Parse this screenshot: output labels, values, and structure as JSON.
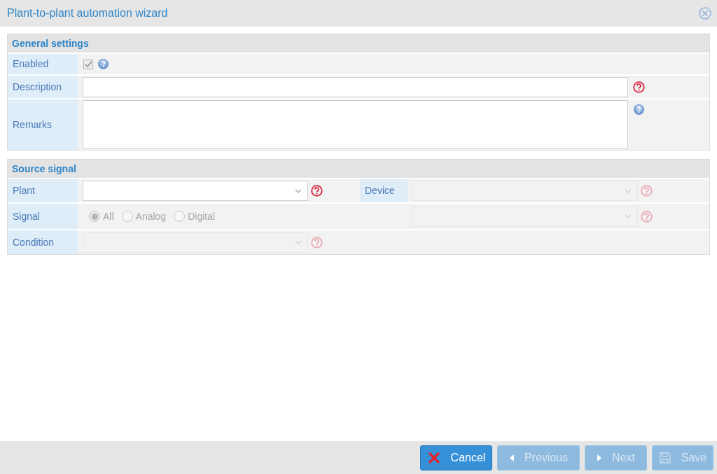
{
  "window": {
    "title": "Plant-to-plant automation wizard"
  },
  "general_settings": {
    "title": "General settings",
    "enabled": {
      "label": "Enabled",
      "checked": true,
      "disabled": true,
      "required": false
    },
    "description": {
      "label": "Description",
      "required": true
    },
    "remarks": {
      "label": "Remarks",
      "required": false
    }
  },
  "source_signal": {
    "title": "Source signal",
    "plant": {
      "label": "Plant",
      "disabled": false,
      "required": true
    },
    "device": {
      "label": "Device",
      "disabled": true,
      "required": true
    },
    "signal": {
      "label": "Signal",
      "disabled": true,
      "options": [
        {
          "label": "All",
          "selected": true
        },
        {
          "label": "Analog",
          "selected": false
        },
        {
          "label": "Digital",
          "selected": false
        }
      ],
      "select": {
        "disabled": true,
        "required": true
      }
    },
    "condition": {
      "label": "Condition",
      "disabled": true,
      "required": true
    }
  },
  "buttons": [
    {
      "kind": "cancel",
      "label": "Cancel",
      "disabled": false
    },
    {
      "kind": "previous",
      "label": "Previous",
      "disabled": true
    },
    {
      "kind": "next",
      "label": "Next",
      "disabled": true
    },
    {
      "kind": "save",
      "label": "Save",
      "disabled": true
    }
  ]
}
